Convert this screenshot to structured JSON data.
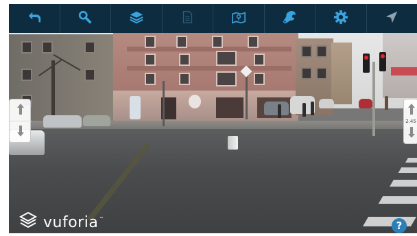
{
  "toolbar": {
    "tools": [
      {
        "icon": "return-icon",
        "enabled": true
      },
      {
        "icon": "search-icon",
        "enabled": true
      },
      {
        "icon": "layers-icon",
        "enabled": true
      },
      {
        "icon": "document-icon",
        "enabled": false
      },
      {
        "icon": "map-icon",
        "enabled": true
      },
      {
        "icon": "wrench-icon",
        "enabled": true
      },
      {
        "icon": "gear-icon",
        "enabled": true
      },
      {
        "icon": "navigation-arrow-icon",
        "enabled": false
      }
    ],
    "colors": {
      "background": "#0d2c3f",
      "accent": "#3aa2dc",
      "disabled": "#2d5a72",
      "nav_disabled": "#8fa3b0"
    }
  },
  "zoom": {
    "value": "2.45"
  },
  "branding": {
    "name": "vuforia",
    "tm": "™"
  },
  "help": {
    "label": "?"
  }
}
